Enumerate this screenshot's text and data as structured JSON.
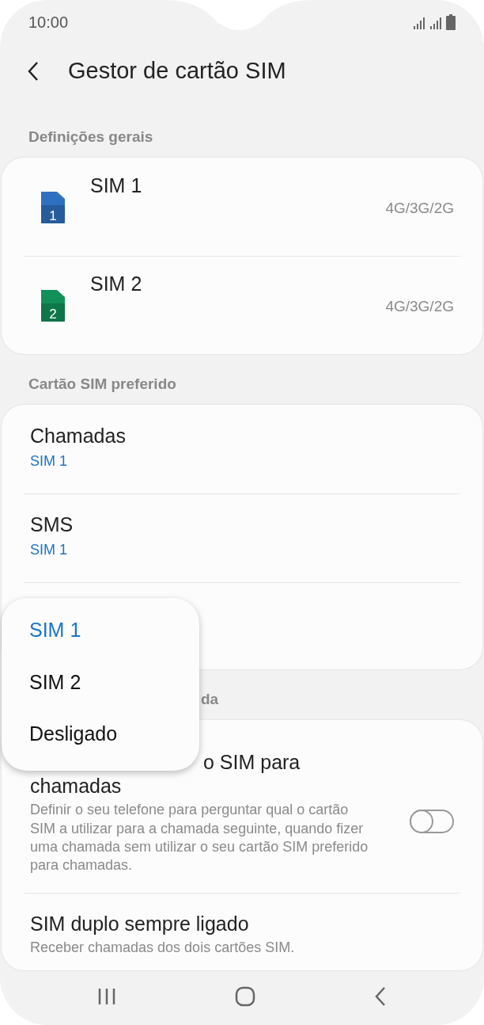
{
  "status_bar": {
    "time": "10:00"
  },
  "header": {
    "title": "Gestor de cartão SIM"
  },
  "sections": [
    {
      "title": "Definições gerais",
      "items": [
        {
          "kind": "sim",
          "title": "SIM 1",
          "number": "1",
          "color": "#2f6fbf",
          "value": "4G/3G/2G"
        },
        {
          "kind": "sim",
          "title": "SIM 2",
          "number": "2",
          "color": "#13905a",
          "value": "4G/3G/2G"
        }
      ]
    },
    {
      "title": "Cartão SIM preferido",
      "items": [
        {
          "kind": "pref",
          "title": "Chamadas",
          "value": "SIM 1"
        },
        {
          "kind": "pref",
          "title": "SMS",
          "value": "SIM 1"
        },
        {
          "kind": "hidden"
        }
      ]
    },
    {
      "title": "da",
      "items": [
        {
          "kind": "toggle",
          "title_parts": [
            "o SIM para",
            "chamadas"
          ],
          "description": "Definir o seu telefone para perguntar qual o cartão SIM a utilizar para a chamada seguinte, quando fizer uma chamada sem utilizar o seu cartão SIM preferido para chamadas.",
          "on": false
        },
        {
          "kind": "text",
          "title": "SIM duplo sempre ligado",
          "description": "Receber chamadas dos dois cartões SIM."
        }
      ]
    }
  ],
  "popup_menu": [
    {
      "label": "SIM 1",
      "selected": true
    },
    {
      "label": "SIM 2",
      "selected": false
    },
    {
      "label": "Desligado",
      "selected": false
    }
  ]
}
